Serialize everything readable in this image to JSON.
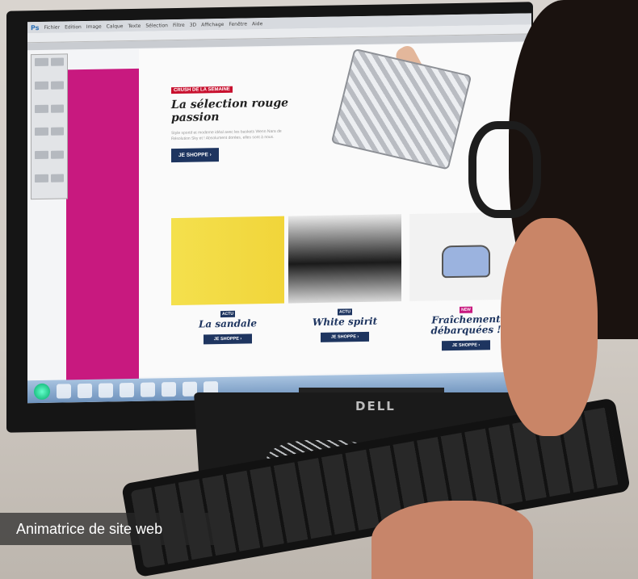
{
  "caption": "Animatrice de site web",
  "screen": {
    "app_menu": [
      "Ps",
      "Fichier",
      "Edition",
      "Image",
      "Calque",
      "Texte",
      "Sélection",
      "Filtre",
      "3D",
      "Affichage",
      "Fenêtre",
      "Aide"
    ],
    "promo": {
      "badge": "CRUSH DE LA SEMAINE",
      "title": "La sélection rouge passion",
      "text": "Style sportif et moderne idéal avec les baskets Wenn Nara de Résolution Sky et ! Absolument dorées, elles sont à nous.",
      "button": "JE SHOPPE ›"
    },
    "cards": [
      {
        "badge": "ACTU",
        "title": "La sandale",
        "button": "JE SHOPPE ›"
      },
      {
        "badge": "ACTU",
        "title": "White spirit",
        "button": "JE SHOPPE ›"
      },
      {
        "badge": "NEW",
        "title": "Fraîchement débarquées !",
        "button": "JE SHOPPE ›"
      }
    ]
  },
  "monitor_brand": "DELL",
  "colors": {
    "magenta": "#c8197f",
    "navy_button": "#1e3560",
    "red_badge": "#c8102e"
  }
}
